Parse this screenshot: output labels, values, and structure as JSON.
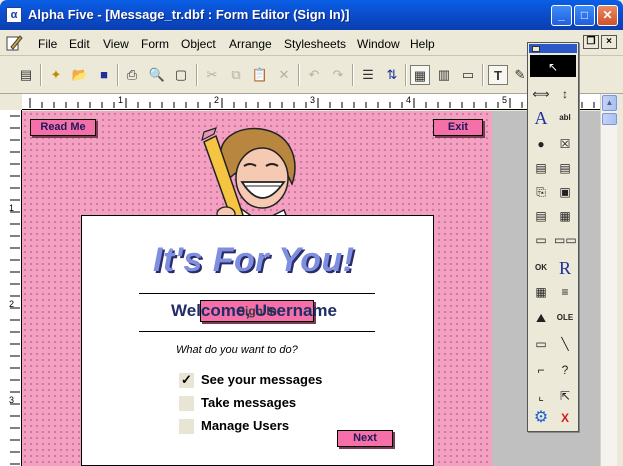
{
  "window": {
    "app_icon": "alpha-five-icon",
    "title": "Alpha Five - [Message_tr.dbf : Form Editor (Sign In)]",
    "controls": {
      "minimize": "_",
      "maximize": "□",
      "close": "✕"
    }
  },
  "menu": {
    "items": [
      "File",
      "Edit",
      "View",
      "Form",
      "Object",
      "Arrange",
      "Stylesheets",
      "Window",
      "Help"
    ],
    "mdi_controls": {
      "minimize": "_",
      "restore": "❐",
      "close": "×"
    }
  },
  "toolbar": {
    "icons": [
      "form-properties-icon",
      "new-icon",
      "open-icon",
      "save-icon",
      "print-icon",
      "print-preview-icon",
      "page-setup-icon",
      "cut-icon",
      "copy-icon",
      "paste-icon",
      "delete-icon",
      "undo-icon",
      "redo-icon",
      "properties-icon",
      "tab-order-icon",
      "design-view-icon",
      "grid-view-icon",
      "layout-view-icon",
      "text-tool-icon",
      "edit-icon"
    ],
    "glyphs": [
      "▤",
      "✦",
      "📂",
      "■",
      "⎙",
      "🔍",
      "▢",
      "✂",
      "⧉",
      "📋",
      "✕",
      "↶",
      "↷",
      "☰",
      "⇅",
      "▦",
      "▥",
      "▭",
      "T",
      "✎"
    ]
  },
  "ruler": {
    "top_labels": [
      "1",
      "2",
      "3",
      "4",
      "5"
    ],
    "left_labels": [
      "1",
      "2",
      "3"
    ]
  },
  "form": {
    "read_me_button": "Read Me",
    "exit_button": "Exit",
    "headline": "It's For You!",
    "overlapping_button": "Sign In",
    "welcome_text": "Welcome, Username",
    "question": "What do you want to do?",
    "options": [
      {
        "label": "See your messages",
        "checked": true
      },
      {
        "label": "Take messages",
        "checked": false
      },
      {
        "label": "Manage Users",
        "checked": false
      }
    ],
    "check_mark": "✓",
    "next_button": "Next",
    "colors": {
      "form_background": "#f3a0c2",
      "button": "#f56fa8",
      "headline": "#7f8fe0",
      "welcome": "#1f2d66"
    }
  },
  "toolbox": {
    "tools": [
      {
        "name": "pointer-tool-icon",
        "glyph": "↖",
        "selected": true
      },
      {
        "name": "resize-horizontal-tool-icon",
        "glyph": "⟺"
      },
      {
        "name": "resize-vertical-tool-icon",
        "glyph": "↕"
      },
      {
        "name": "label-tool-icon",
        "glyph": "A"
      },
      {
        "name": "field-tool-icon",
        "glyph": "abl"
      },
      {
        "name": "radio-button-tool-icon",
        "glyph": "●"
      },
      {
        "name": "checkbox-tool-icon",
        "glyph": "☒"
      },
      {
        "name": "list-box-tool-icon",
        "glyph": "▤"
      },
      {
        "name": "memo-tool-icon",
        "glyph": "▤"
      },
      {
        "name": "tab-tool-icon",
        "glyph": "⎘"
      },
      {
        "name": "combo-tool-icon",
        "glyph": "▣"
      },
      {
        "name": "frame-tool-icon",
        "glyph": "▤"
      },
      {
        "name": "embedded-browse-tool-icon",
        "glyph": "▦"
      },
      {
        "name": "button-tool-icon",
        "glyph": "▭"
      },
      {
        "name": "button-bar-tool-icon",
        "glyph": "▭▭"
      },
      {
        "name": "ok-button-tool-icon",
        "glyph": "OK"
      },
      {
        "name": "rich-text-tool-icon",
        "glyph": "R"
      },
      {
        "name": "browse-tool-icon",
        "glyph": "▦"
      },
      {
        "name": "browse-column-tool-icon",
        "glyph": "≡"
      },
      {
        "name": "image-tool-icon",
        "glyph": "⛰"
      },
      {
        "name": "ole-tool-icon",
        "glyph": "OLE"
      },
      {
        "name": "rectangle-tool-icon",
        "glyph": "▭"
      },
      {
        "name": "line-tool-icon",
        "glyph": "╲"
      },
      {
        "name": "bracket-tool-icon",
        "glyph": "⌐"
      },
      {
        "name": "help-tool-icon",
        "glyph": "?"
      },
      {
        "name": "corner-tool-icon",
        "glyph": "⌞"
      },
      {
        "name": "hotspot-tool-icon",
        "glyph": "⇱"
      },
      {
        "name": "gear-icon",
        "glyph": "⚙"
      },
      {
        "name": "close-toolbox-icon",
        "glyph": "X"
      }
    ]
  }
}
